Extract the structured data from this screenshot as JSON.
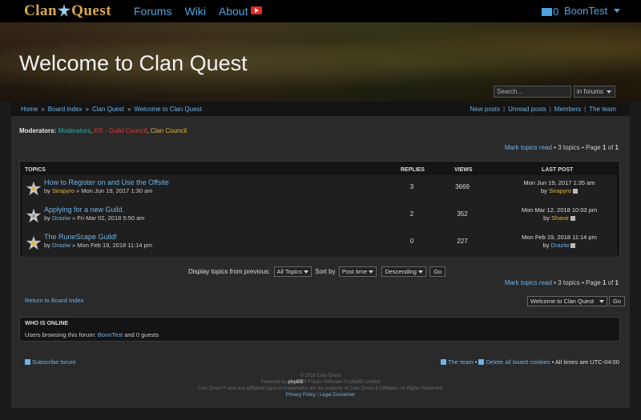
{
  "nav": {
    "logo_left": "Clan",
    "logo_right": "Quest",
    "links": [
      "Forums",
      "Wiki",
      "About"
    ],
    "youtube_icon": "youtube-icon",
    "messages_count": "0",
    "username": "BoonTest"
  },
  "hero": {
    "title": "Welcome to Clan Quest",
    "search_placeholder": "Search…",
    "search_scope": "in forums"
  },
  "breadcrumb": {
    "items": [
      "Home",
      "Board index",
      "Clan Quest",
      "Welcome to Clan Quest"
    ]
  },
  "quicklinks": [
    "New posts",
    "Unread posts",
    "Members",
    "The team"
  ],
  "moderators": {
    "label": "Moderators:",
    "groups": [
      "Moderators",
      "RS - Guild Council",
      "Clan Council"
    ],
    "colors": {
      "Moderators": "#2bb0b0",
      "RS - Guild Council": "#d53b3b",
      "Clan Council": "#e3b43c"
    }
  },
  "pagination": {
    "mark_read": "Mark topics read",
    "topics_count": "3 topics",
    "page_prefix": "Page",
    "page_current": "1",
    "page_of": "of",
    "page_total": "1"
  },
  "table": {
    "headers": {
      "topics": "TOPICS",
      "replies": "REPLIES",
      "views": "VIEWS",
      "last_post": "LAST POST"
    },
    "rows": [
      {
        "title": "How to Register on and Use the Offsite",
        "by": "by",
        "author": "Sirapyro",
        "date": "» Mon Jun 19, 2017 1:30 am",
        "replies": "3",
        "views": "3669",
        "last_date": "Mon Jun 19, 2017 1:35 am",
        "last_by": "by",
        "last_author": "Sirapyro",
        "author_color": "#e3b43c"
      },
      {
        "title": "Applying for a new Guild.",
        "by": "by",
        "author": "Draziw",
        "date": "» Fri Mar 02, 2018 5:50 am",
        "replies": "2",
        "views": "352",
        "last_date": "Mon Mar 12, 2018 10:03 pm",
        "last_by": "by",
        "last_author": "Shane",
        "author_color": "#6fb3e8"
      },
      {
        "title": "The RuneScape Guild!",
        "by": "by",
        "author": "Draziw",
        "date": "» Mon Feb 19, 2018 11:14 pm",
        "replies": "0",
        "views": "227",
        "last_date": "Mon Feb 19, 2018 11:14 pm",
        "last_by": "by",
        "last_author": "Draziw",
        "author_color": "#6fb3e8"
      }
    ]
  },
  "controls": {
    "display_label": "Display topics from previous:",
    "display_value": "All Topics",
    "sort_label": "Sort by",
    "sort_value": "Post time",
    "order_value": "Descending",
    "go": "Go"
  },
  "return_link": "Return to Board Index",
  "jump": {
    "value": "Welcome to Clan Quest",
    "go": "Go"
  },
  "who_is_online": {
    "heading": "WHO IS ONLINE",
    "text_prefix": "Users browsing this forum:",
    "user": "BoonTest",
    "text_suffix": "and 0 guests"
  },
  "footer": {
    "subscribe": "Subscribe forum",
    "team": "The team",
    "delete_cookies": "Delete all board cookies",
    "timezone": "All times are UTC-04:00",
    "copyright": "© 2018 Clan Quest",
    "powered_prefix": "Powered by",
    "powered_name": "phpBB",
    "powered_suffix": "® Forum Software © phpBB Limited",
    "trademark": "Clan Quest™ and any affiliated logos or trademarks are the property of Clan Quest & Affiliates. All Rights Reserved.",
    "privacy": "Privacy Policy",
    "disclaimer": "Legal Disclaimer"
  }
}
